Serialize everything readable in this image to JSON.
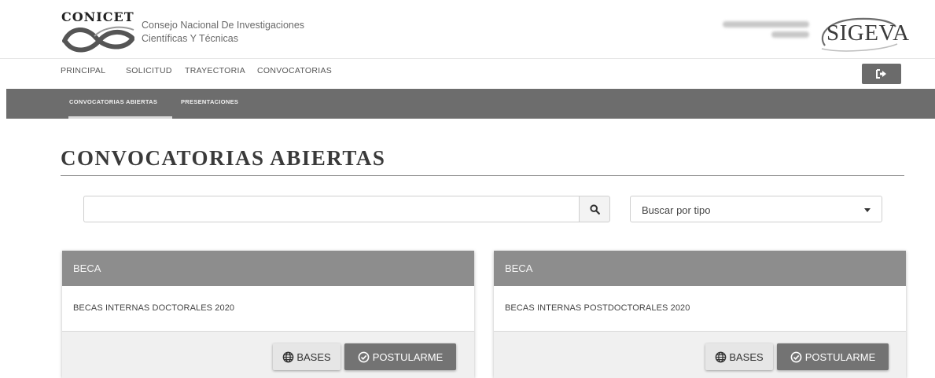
{
  "header": {
    "brand_word": "CONICET",
    "brand_name_line1": "Consejo Nacional De Investigaciones",
    "brand_name_line2": "Científicas Y Técnicas",
    "app_logo": "SIGEVA"
  },
  "nav": {
    "items": [
      {
        "label": "PRINCIPAL"
      },
      {
        "label": "SOLICITUD"
      },
      {
        "label": "TRAYECTORIA"
      },
      {
        "label": "CONVOCATORIAS"
      }
    ],
    "logout_icon": "sign-out-icon"
  },
  "subnav": {
    "items": [
      {
        "label": "CONVOCATORIAS ABIERTAS",
        "active": true
      },
      {
        "label": "PRESENTACIONES",
        "active": false
      }
    ]
  },
  "main": {
    "title": "CONVOCATORIAS ABIERTAS",
    "search": {
      "value": "",
      "icon": "search-icon"
    },
    "type_filter": {
      "selected": "Buscar por tipo"
    },
    "cards": [
      {
        "type": "BECA",
        "title": "BECAS INTERNAS DOCTORALES 2020",
        "bases_label": "BASES",
        "postular_label": "POSTULARME"
      },
      {
        "type": "BECA",
        "title": "BECAS INTERNAS POSTDOCTORALES 2020",
        "bases_label": "BASES",
        "postular_label": "POSTULARME"
      }
    ]
  },
  "colors": {
    "subnav_bg": "#6d6d6d",
    "card_header_bg": "#8d8d8d",
    "primary_button": "#737373"
  }
}
